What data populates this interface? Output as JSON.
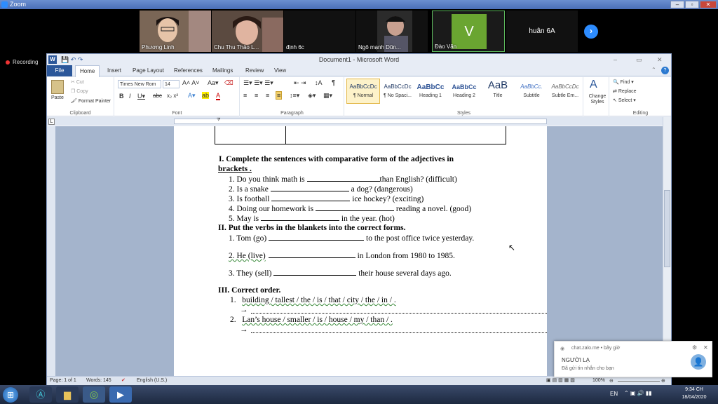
{
  "zoom": {
    "title": "Zoom",
    "recording": "Recording",
    "participants": [
      {
        "name": "Phương Linh"
      },
      {
        "name": "Chu Thu Thảo L..."
      },
      {
        "name": "định 6c"
      },
      {
        "name": "Ngô mạnh Dũn..."
      },
      {
        "name": "Đào Văn",
        "initial": "V"
      },
      {
        "name": "huân 6A"
      }
    ]
  },
  "word": {
    "title": "Document1 - Microsoft Word",
    "tabs": [
      "File",
      "Home",
      "Insert",
      "Page Layout",
      "References",
      "Mailings",
      "Review",
      "View"
    ],
    "clipboard": {
      "paste": "Paste",
      "cut": "Cut",
      "copy": "Copy",
      "format_painter": "Format Painter",
      "label": "Clipboard"
    },
    "font": {
      "name": "Times New Rom",
      "size": "14",
      "label": "Font"
    },
    "paragraph_label": "Paragraph",
    "styles": [
      {
        "preview": "AaBbCcDc",
        "name": "¶ Normal"
      },
      {
        "preview": "AaBbCcDc",
        "name": "¶ No Spaci..."
      },
      {
        "preview": "AaBbCc",
        "name": "Heading 1"
      },
      {
        "preview": "AaBbCc",
        "name": "Heading 2"
      },
      {
        "preview": "AaB",
        "name": "Title"
      },
      {
        "preview": "AaBbCc.",
        "name": "Subtitle"
      },
      {
        "preview": "AaBbCcDc",
        "name": "Subtle Em..."
      }
    ],
    "styles_label": "Styles",
    "change_styles": "Change Styles",
    "editing": {
      "find": "Find",
      "replace": "Replace",
      "select": "Select",
      "label": "Editing"
    },
    "status": {
      "page": "Page: 1 of 1",
      "words": "Words: 145",
      "language": "English (U.S.)",
      "zoom": "100%"
    }
  },
  "document": {
    "s1_title_a": "I.   Complete  the  sentences  with  comparative  form  of  the  adjectives  in",
    "s1_title_b": "brackets .",
    "s1_items": [
      {
        "pre": "1.   Do you think math is ",
        "post": "than English? (difficult)"
      },
      {
        "pre": "2.   Is a snake ",
        "post": " a dog? (dangerous)"
      },
      {
        "pre": "3.   Is football ",
        "post": " ice hockey? (exciting)"
      },
      {
        "pre": "4.   Doing our homework is ",
        "post": " reading a novel. (good)"
      },
      {
        "pre": "5.   May is ",
        "post": " in the year. (hot)"
      }
    ],
    "s2_title": "II. Put the verbs in the blankets into the correct forms.",
    "s2_items": [
      {
        "pre": "1. Tom (go) ",
        "post": " to the post office twice yesterday."
      },
      {
        "pre": "2. He (live)",
        "post": " in London from 1980 to 1985."
      },
      {
        "pre": "3. They (sell) ",
        "post": " their house several days ago."
      }
    ],
    "s3_title": "III. Correct order.",
    "s3_items": [
      {
        "num": "1.",
        "text": "building / tallest / the / is / that / city / the / in / ."
      },
      {
        "num": "2.",
        "text": "Lan’s house / smaller / is / house / my / than / ."
      }
    ],
    "arrow": "→"
  },
  "notification": {
    "source": "chat.zalo.me • bây giờ",
    "sender": "NGƯỜI LẠ",
    "message": "Đã gửi tin nhắn cho bạn"
  },
  "taskbar": {
    "lang": "EN",
    "time": "9:34 CH",
    "date": "18/04/2020"
  }
}
